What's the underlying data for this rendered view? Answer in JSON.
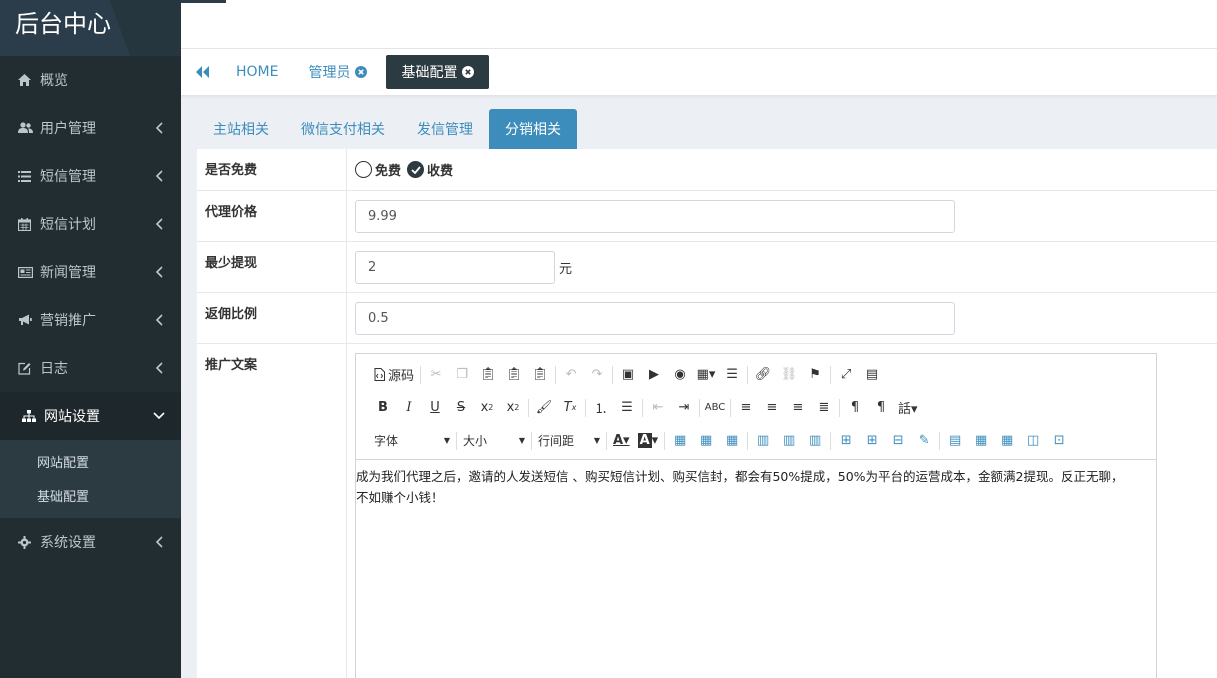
{
  "app": {
    "brand": "后台中心"
  },
  "sidebar": {
    "items": [
      {
        "label": "概览",
        "icon": "home-icon",
        "chevron": false
      },
      {
        "label": "用户管理",
        "icon": "users-icon",
        "chevron": true
      },
      {
        "label": "短信管理",
        "icon": "list-icon",
        "chevron": true
      },
      {
        "label": "短信计划",
        "icon": "calendar-icon",
        "chevron": true
      },
      {
        "label": "新闻管理",
        "icon": "newspaper-icon",
        "chevron": true
      },
      {
        "label": "营销推广",
        "icon": "bullhorn-icon",
        "chevron": true
      },
      {
        "label": "日志",
        "icon": "edit-icon",
        "chevron": true
      }
    ],
    "open_item": {
      "label": "网站设置",
      "icon": "sitemap-icon"
    },
    "sub_items": [
      "网站配置",
      "基础配置"
    ],
    "last_item": {
      "label": "系统设置",
      "icon": "gear-icon"
    }
  },
  "page_tabs": [
    {
      "label": "HOME",
      "closable": false,
      "active": false
    },
    {
      "label": "管理员",
      "closable": true,
      "active": false
    },
    {
      "label": "基础配置",
      "closable": true,
      "active": true
    }
  ],
  "content_tabs": [
    "主站相关",
    "微信支付相关",
    "发信管理",
    "分销相关"
  ],
  "active_content_tab": "分销相关",
  "form": {
    "free": {
      "label": "是否免费",
      "options": [
        "免费",
        "收费"
      ],
      "selected": "收费"
    },
    "agent_price": {
      "label": "代理价格",
      "value": "9.99"
    },
    "min_withdraw": {
      "label": "最少提现",
      "value": "2",
      "unit": "元"
    },
    "commission": {
      "label": "返佣比例",
      "value": "0.5"
    },
    "promo": {
      "label": "推广文案"
    }
  },
  "editor": {
    "source_label": "源码",
    "font_label": "字体",
    "size_label": "大小",
    "line_height_label": "行间距",
    "line1": "成为我们代理之后，邀请的人发送短信 、购买短信计划、购买信封，都会有50%提成，50%为平台的运营成本，金额满2提现。反正无聊，",
    "line2": "不如赚个小钱！"
  }
}
